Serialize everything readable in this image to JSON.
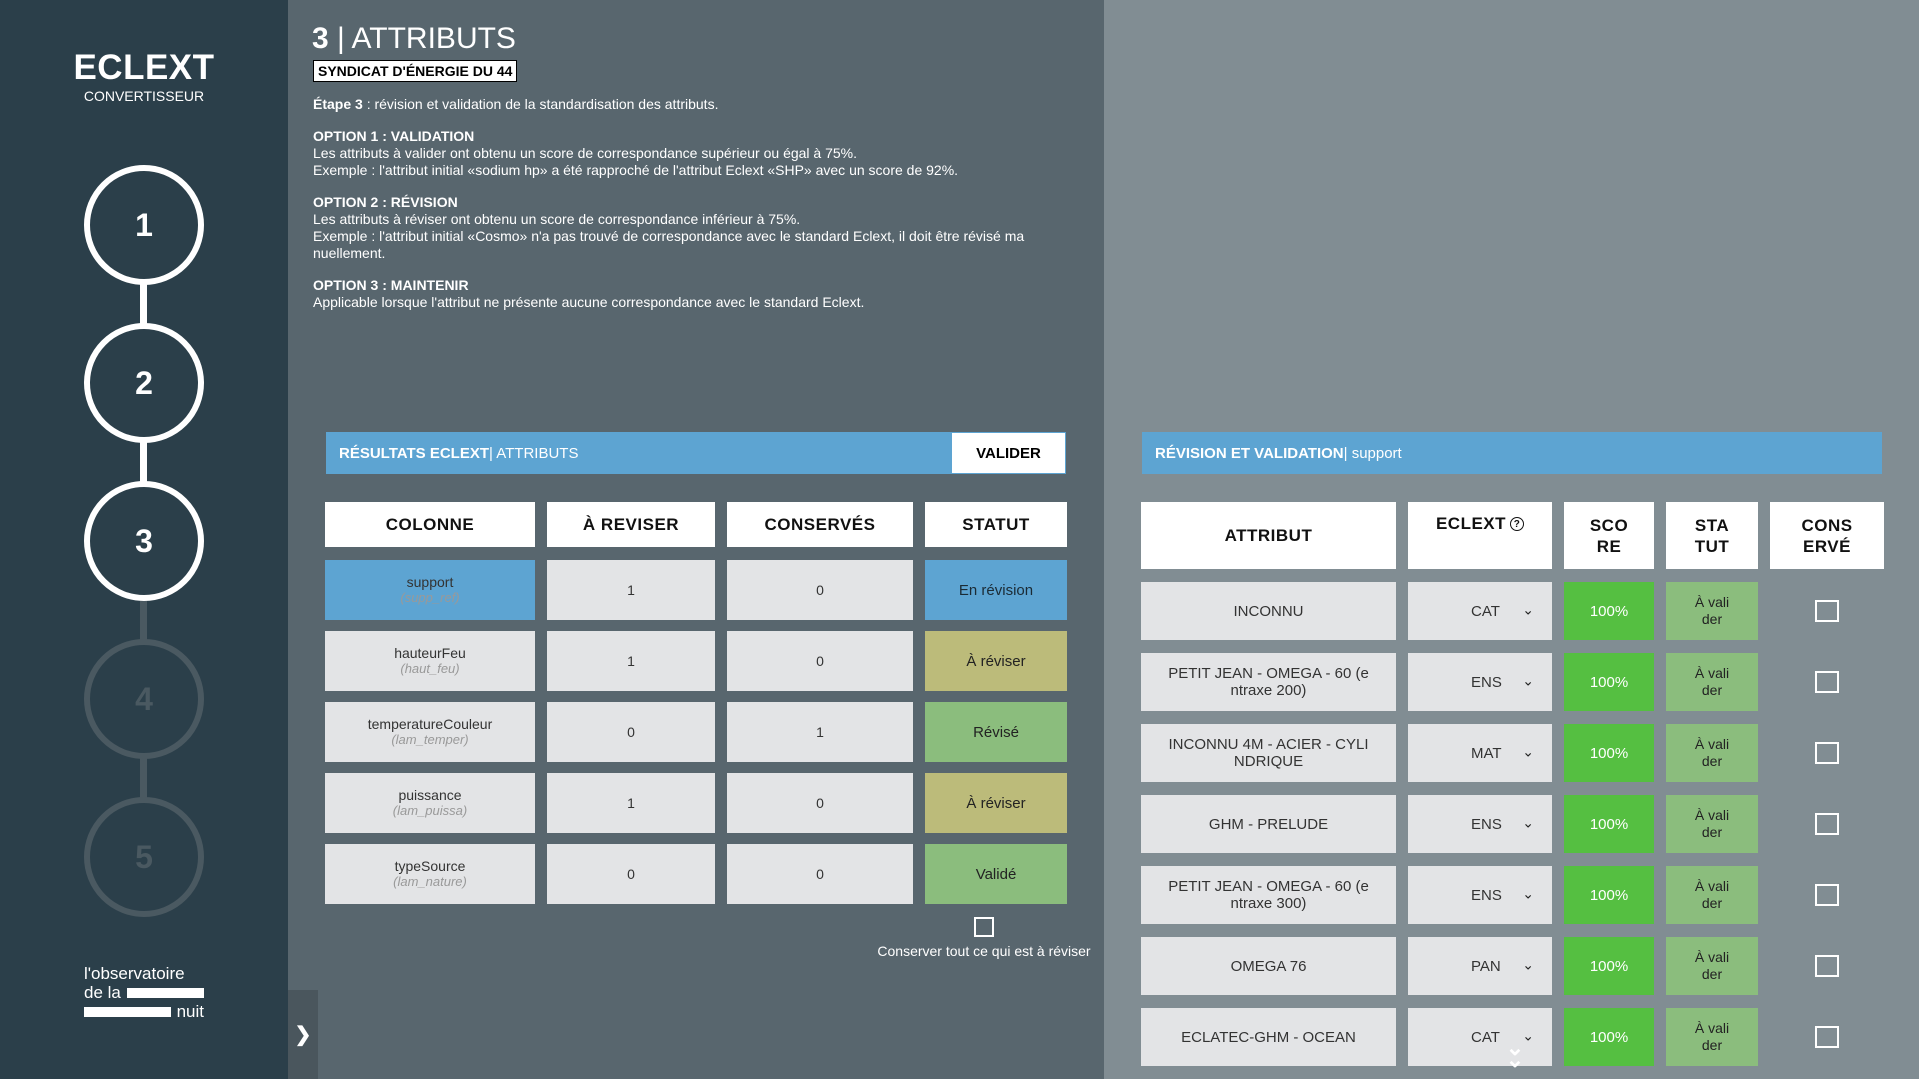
{
  "sidebar": {
    "brand": "ECLEXT",
    "subtitle": "CONVERTISSEUR",
    "steps": [
      "1",
      "2",
      "3",
      "4",
      "5"
    ],
    "logo_line1": "l'observatoire",
    "logo_line2": "de la",
    "logo_line3": "nuit"
  },
  "header": {
    "step_number": "3",
    "separator": " | ",
    "title": "ATTRIBUTS",
    "organization": "SYNDICAT D'ÉNERGIE DU 44"
  },
  "intro": {
    "step_label": "Étape 3",
    "step_text": " : révision et validation de la standardisation des attributs.",
    "option1_title": "OPTION 1 : VALIDATION",
    "option1_line1": "Les attributs à valider ont obtenu un score de correspondance supérieur ou égal à 75%.",
    "option1_line2": "Exemple : l'attribut initial «sodium hp» a été rapproché de l'attribut Eclext «SHP» avec un score de 92%.",
    "option2_title": "OPTION 2 : RÉVISION",
    "option2_line1": "Les attributs à réviser ont obtenu un score de correspondance inférieur à 75%.",
    "option2_line2": "Exemple : l'attribut initial «Cosmo» n'a pas trouvé de correspondance avec le standard Eclext, il doit être révisé ma nuellement.",
    "option3_title": "OPTION 3 : MAINTENIR",
    "option3_line1": "Applicable lorsque l'attribut ne présente aucune correspondance avec le standard Eclext."
  },
  "results": {
    "title_bold": "RÉSULTATS ECLEXT",
    "title_rest": " | ATTRIBUTS",
    "validate_label": "VALIDER",
    "columns": [
      "COLONNE",
      "À REVISER",
      "CONSERVÉS",
      "STATUT"
    ],
    "rows": [
      {
        "name": "support",
        "sub": "(supp_ref)",
        "to_review": "1",
        "kept": "0",
        "status": "En révision"
      },
      {
        "name": "hauteurFeu",
        "sub": "(haut_feu)",
        "to_review": "1",
        "kept": "0",
        "status": "À réviser"
      },
      {
        "name": "temperatureCouleur",
        "sub": "(lam_temper)",
        "to_review": "0",
        "kept": "1",
        "status": "Révisé"
      },
      {
        "name": "puissance",
        "sub": "(lam_puissa)",
        "to_review": "1",
        "kept": "0",
        "status": "À réviser"
      },
      {
        "name": "typeSource",
        "sub": "(lam_nature)",
        "to_review": "0",
        "kept": "0",
        "status": "Validé"
      }
    ],
    "keep_all_label": "Conserver tout ce qui est à réviser"
  },
  "review": {
    "title_bold": "RÉVISION ET VALIDATION",
    "title_rest": " | support",
    "columns": {
      "attribute": "ATTRIBUT",
      "eclext": "ECLEXT",
      "score_1": "SCO",
      "score_2": "RE",
      "status_1": "STA",
      "status_2": "TUT",
      "kept_1": "CONS",
      "kept_2": "ERVÉ"
    },
    "help_icon": "?",
    "rows": [
      {
        "attribute_1": "INCONNU",
        "attribute_2": "",
        "eclext": "CAT",
        "score": "100%",
        "status_1": "À vali",
        "status_2": "der"
      },
      {
        "attribute_1": "PETIT JEAN - OMEGA - 60 (e",
        "attribute_2": "ntraxe 200)",
        "eclext": "ENS",
        "score": "100%",
        "status_1": "À vali",
        "status_2": "der"
      },
      {
        "attribute_1": "INCONNU 4M - ACIER - CYLI",
        "attribute_2": "NDRIQUE",
        "eclext": "MAT",
        "score": "100%",
        "status_1": "À vali",
        "status_2": "der"
      },
      {
        "attribute_1": "GHM - PRELUDE",
        "attribute_2": "",
        "eclext": "ENS",
        "score": "100%",
        "status_1": "À vali",
        "status_2": "der"
      },
      {
        "attribute_1": "PETIT JEAN - OMEGA - 60 (e",
        "attribute_2": "ntraxe 300)",
        "eclext": "ENS",
        "score": "100%",
        "status_1": "À vali",
        "status_2": "der"
      },
      {
        "attribute_1": "OMEGA 76",
        "attribute_2": "",
        "eclext": "PAN",
        "score": "100%",
        "status_1": "À vali",
        "status_2": "der"
      },
      {
        "attribute_1": "ECLATEC-GHM - OCEAN",
        "attribute_2": "",
        "eclext": "CAT",
        "score": "100%",
        "status_1": "À vali",
        "status_2": "der"
      }
    ]
  },
  "icons": {
    "collapse": "chevron-right-icon",
    "dropdown": "chevron-down-icon",
    "scroll": "double-chevron-down-icon"
  }
}
